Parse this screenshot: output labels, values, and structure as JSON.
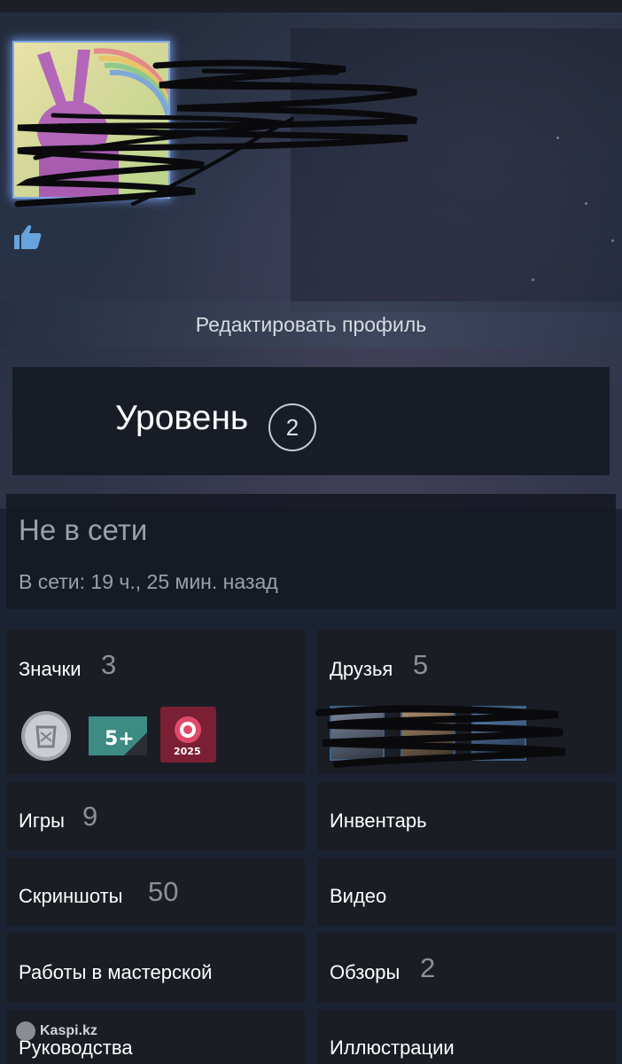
{
  "profile": {
    "edit_label": "Редактировать профиль",
    "level_label": "Уровень",
    "level_value": "2",
    "status": "Не в сети",
    "last_online": "В сети: 19 ч., 25 мин. назад"
  },
  "tiles": {
    "badges": {
      "label": "Значки",
      "count": "3"
    },
    "friends": {
      "label": "Друзья",
      "count": "5"
    },
    "games": {
      "label": "Игры",
      "count": "9"
    },
    "inventory": {
      "label": "Инвентарь"
    },
    "screenshots": {
      "label": "Скриншоты",
      "count": "50"
    },
    "videos": {
      "label": "Видео"
    },
    "workshop": {
      "label": "Работы в мастерской"
    },
    "reviews": {
      "label": "Обзоры",
      "count": "2"
    },
    "guides": {
      "label": "Руководства"
    },
    "artwork": {
      "label": "Иллюстрации"
    }
  },
  "badges": [
    {
      "icon": "silver-coin-badge-icon"
    },
    {
      "icon": "years-of-service-badge-icon",
      "text": "5+"
    },
    {
      "icon": "steam-replay-badge-icon",
      "text": "2025"
    }
  ],
  "watermark": "Kaspi.kz",
  "colors": {
    "background": "#1b2332",
    "tile": "#1a1d24",
    "count_text": "#8b9099",
    "avatar_glow": "#7fa6e6",
    "thumb_icon": "#67a3dc"
  }
}
